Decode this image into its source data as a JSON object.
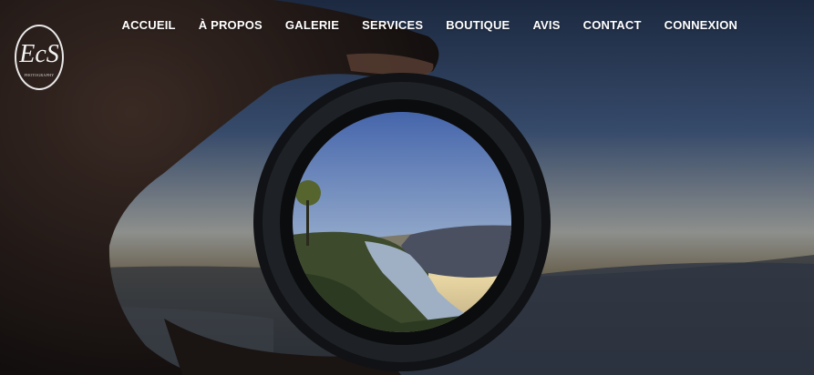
{
  "brand": {
    "logo_text": "EcS",
    "logo_subtitle": "PHOTOGRAPHY"
  },
  "nav": {
    "items": [
      {
        "label": "ACCUEIL"
      },
      {
        "label": "À PROPOS"
      },
      {
        "label": "GALERIE"
      },
      {
        "label": "SERVICES"
      },
      {
        "label": "BOUTIQUE"
      },
      {
        "label": "AVIS"
      },
      {
        "label": "CONTACT"
      },
      {
        "label": "CONNEXION"
      }
    ]
  },
  "hero": {
    "image": "hand-holding-lens-over-lake-landscape"
  }
}
